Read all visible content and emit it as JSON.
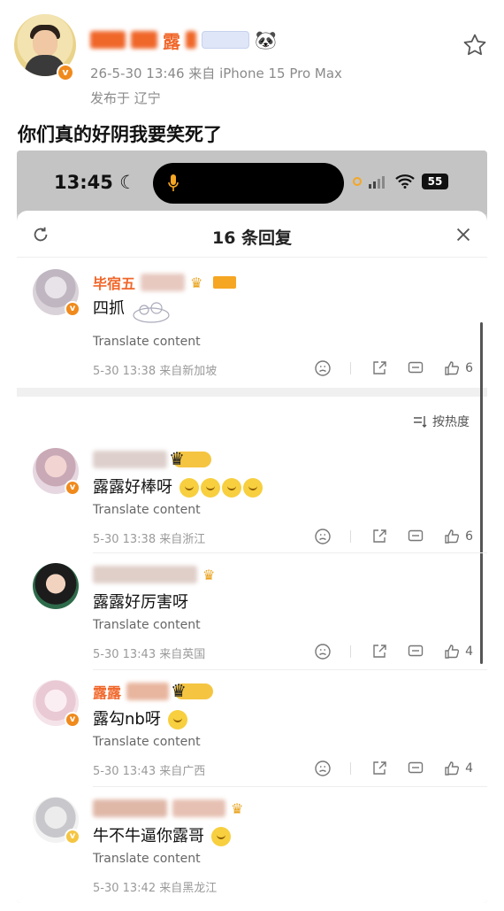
{
  "post": {
    "username": "露",
    "meta": "26-5-30 13:46  来自 iPhone 15 Pro Max",
    "location": "发布于 辽宁",
    "text": "你们真的好阴我要笑死了",
    "avatar_badge": "v"
  },
  "screenshot": {
    "status": {
      "time": "13:45",
      "moon": "☾",
      "battery": "55"
    },
    "sheet": {
      "title": "16 条回复"
    },
    "sort_label": "按热度",
    "top_comment": {
      "name": "毕宿五",
      "text": "四抓",
      "translate": "Translate content",
      "meta": "5-30 13:38  来自新加坡",
      "likes": "6"
    },
    "comments": [
      {
        "name": "",
        "text": "露露好棒呀",
        "translate": "Translate content",
        "meta": "5-30 13:38  来自浙江",
        "likes": "6"
      },
      {
        "name": "",
        "text": "露露好厉害呀",
        "translate": "Translate content",
        "meta": "5-30 13:43  来自英国",
        "likes": "4"
      },
      {
        "name": "露露",
        "text": "露勾nb呀",
        "translate": "Translate content",
        "meta": "5-30 13:43  来自广西",
        "likes": "4"
      },
      {
        "name": "",
        "text": "牛不牛逼你露哥",
        "translate": "Translate content",
        "meta": "5-30 13:42  来自黑龙江",
        "likes": ""
      }
    ]
  },
  "colors": {
    "username": "#f0672a",
    "badge": "#f08a1c",
    "meta": "#8a8a8a"
  }
}
